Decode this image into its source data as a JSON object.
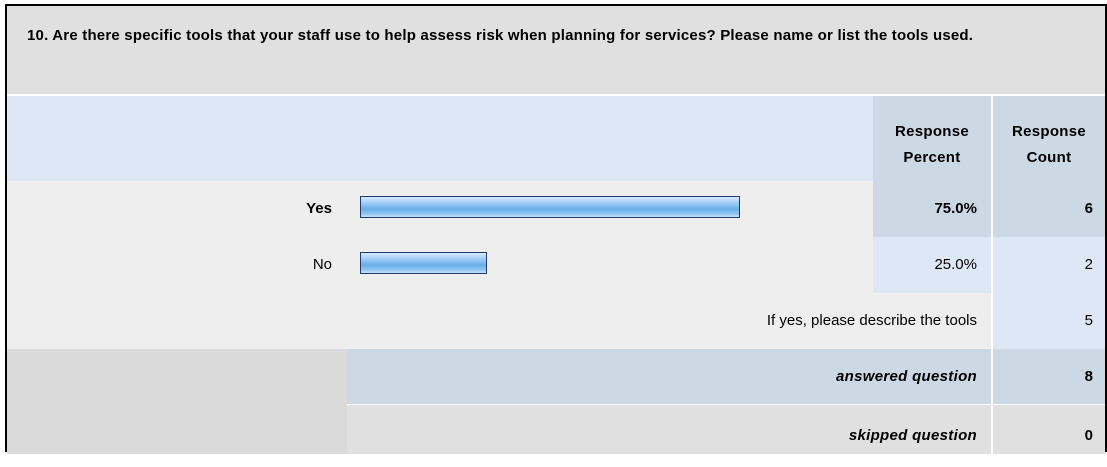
{
  "question": {
    "text": "10. Are there specific tools that your staff use to help assess risk when planning for services? Please name or list the tools used."
  },
  "headers": {
    "response_percent": "Response Percent",
    "response_count": "Response Count"
  },
  "rows": [
    {
      "label": "Yes",
      "percent": "75.0%",
      "count": "6",
      "bold": true
    },
    {
      "label": "No",
      "percent": "25.0%",
      "count": "2",
      "bold": false
    }
  ],
  "other": {
    "label": "If yes, please describe the tools",
    "count": "5"
  },
  "summary": {
    "answered_label": "answered question",
    "answered_count": "8",
    "skipped_label": "skipped question",
    "skipped_count": "0"
  },
  "chart_data": {
    "type": "bar",
    "categories": [
      "Yes",
      "No"
    ],
    "values": [
      75.0,
      25.0
    ],
    "counts": [
      6,
      2
    ],
    "xlim": [
      0,
      100
    ],
    "ylabel": "Response Percent",
    "colors": {
      "bar": "#7ab8ee",
      "bar_border": "#1f3b66"
    }
  }
}
